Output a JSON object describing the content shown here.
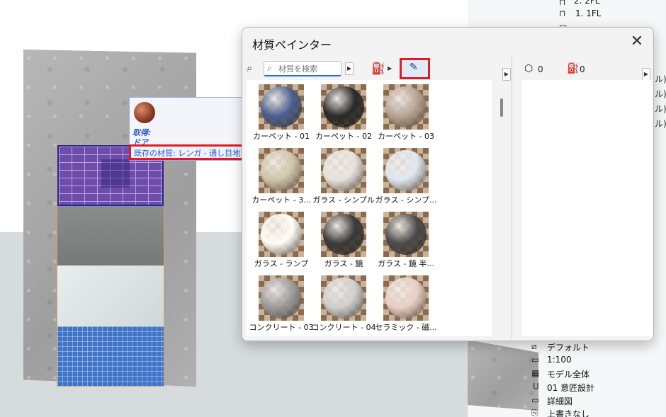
{
  "dialog": {
    "title": "材質ペインター",
    "search_placeholder": "材質を検索",
    "cube_count": "0",
    "bucket_count": "0",
    "materials": [
      {
        "label": "カーペット - 01",
        "color": "#4b5f8f"
      },
      {
        "label": "カーペット - 02",
        "color": "#2a2a2a"
      },
      {
        "label": "カーペット - 03",
        "color": "#b8a394"
      },
      {
        "label": "カーペット - 3...",
        "color": "#cfc6a9"
      },
      {
        "label": "ガラス - シンプル",
        "color": "#e6e2dc"
      },
      {
        "label": "ガラス - シンプ...",
        "color": "#dfe6ee"
      },
      {
        "label": "ガラス - ランプ",
        "color": "#fffdf4"
      },
      {
        "label": "ガラス - 鏡",
        "color": "#3a3a3a"
      },
      {
        "label": "ガラス - 鏡 半...",
        "color": "#4a4a4a"
      },
      {
        "label": "コンクリート - 03",
        "color": "#9b9c9a"
      },
      {
        "label": "コンクリート - 04",
        "color": "#cfcfcc"
      },
      {
        "label": "セラミック - 磁...",
        "color": "#e7cfc4"
      }
    ]
  },
  "tooltip": {
    "get_label": "取得:",
    "object_label": "ドア",
    "existing_material": "既存の材質: レンガ - 通し目地"
  },
  "right_panel": {
    "top_items": [
      {
        "label": "2. 2FL"
      },
      {
        "label": "1. 1FL"
      },
      {
        "label": "..."
      }
    ],
    "edge_fragments": [
      "ル)",
      "ル)",
      "ル)",
      "ル)"
    ],
    "bottom_items": [
      {
        "icon": "layer-icon",
        "label": "デフォルト"
      },
      {
        "icon": "scale-icon",
        "label": "1:100"
      },
      {
        "icon": "model-icon",
        "label": "モデル全体"
      },
      {
        "icon": "pen-icon",
        "label": "01 意匠設計"
      },
      {
        "icon": "detail-icon",
        "label": "詳細図"
      },
      {
        "icon": "override-icon",
        "label": "上書きなし"
      }
    ]
  }
}
